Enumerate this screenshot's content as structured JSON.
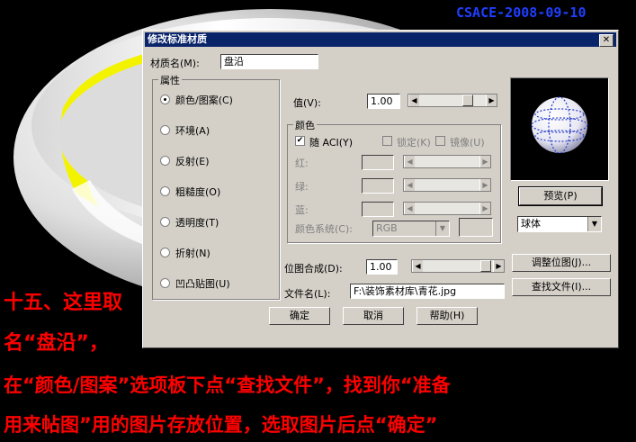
{
  "watermark": "CSACE-2008-09-10",
  "dialog": {
    "title": "修改标准材质",
    "close_glyph": "✕",
    "material_name_label": "材质名(M):",
    "material_name_value": "盘沿",
    "attributes": {
      "title": "属性",
      "options": [
        "颜色/图案(C)",
        "环境(A)",
        "反射(E)",
        "粗糙度(O)",
        "透明度(T)",
        "折射(N)",
        "凹凸贴图(U)"
      ],
      "selected_index": 0
    },
    "value_label": "值(V):",
    "value": "1.00",
    "color_group": {
      "title": "颜色",
      "follow_aci": "随 ACI(Y)",
      "lock": "锁定(K)",
      "mirror": "镜像(U)",
      "red": "红:",
      "green": "绿:",
      "blue": "蓝:",
      "color_system_label": "颜色系统(C):",
      "color_system_value": "RGB"
    },
    "bitmap_blend_label": "位图合成(D):",
    "bitmap_blend_value": "1.00",
    "file_name_label": "文件名(L):",
    "file_name_value": "F:\\装饰素材库\\青花.jpg",
    "adjust_bitmap_button": "调整位图(J)...",
    "find_file_button": "查找文件(I)...",
    "preview_button": "预览(P)",
    "preview_shape": "球体",
    "ok_button": "确定",
    "cancel_button": "取消",
    "help_button": "帮助(H)"
  },
  "annotation": {
    "line1": "十五、这里取",
    "line2": "名“盘沿”，",
    "line3": "在“颜色/图案”选项板下点“查找文件”，找到你“准备",
    "line4": "用来帖图”用的图片存放位置，选取图片后点“确定”"
  },
  "colors": {
    "annotation": "#ff0000",
    "watermark": "#1f3fff",
    "titlebar": "#0a246a",
    "dialog_bg": "#d4d0c8"
  }
}
